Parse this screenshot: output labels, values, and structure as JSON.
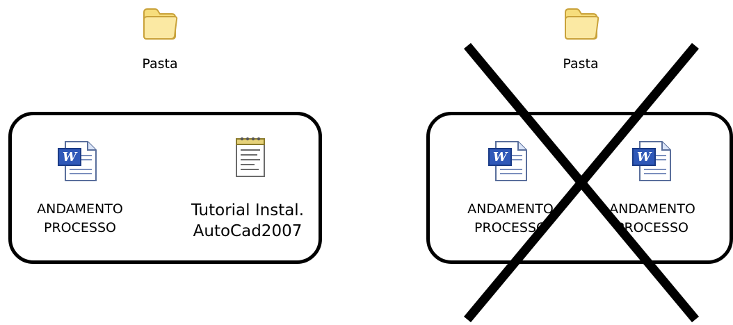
{
  "left_panel": {
    "folder": {
      "icon": "folder-icon",
      "label": "Pasta"
    },
    "files": [
      {
        "icon": "word-document-icon",
        "line1": "ANDAMENTO",
        "line2": "PROCESSO"
      },
      {
        "icon": "notepad-text-file-icon",
        "line1": "Tutorial Instal.",
        "line2": "AutoCad2007"
      }
    ]
  },
  "right_panel": {
    "folder": {
      "icon": "folder-icon",
      "label": "Pasta"
    },
    "files": [
      {
        "icon": "word-document-icon",
        "line1": "ANDAMENTO",
        "line2": "PROCESSO"
      },
      {
        "icon": "word-document-icon",
        "line1": "ANDAMENTO",
        "line2": "PROCESSO"
      }
    ],
    "crossed_out": true
  },
  "colors": {
    "folder_fill": "#f6dd7c",
    "folder_outline": "#c9a23a",
    "word_blue": "#2f58b8",
    "outline": "#000000"
  }
}
